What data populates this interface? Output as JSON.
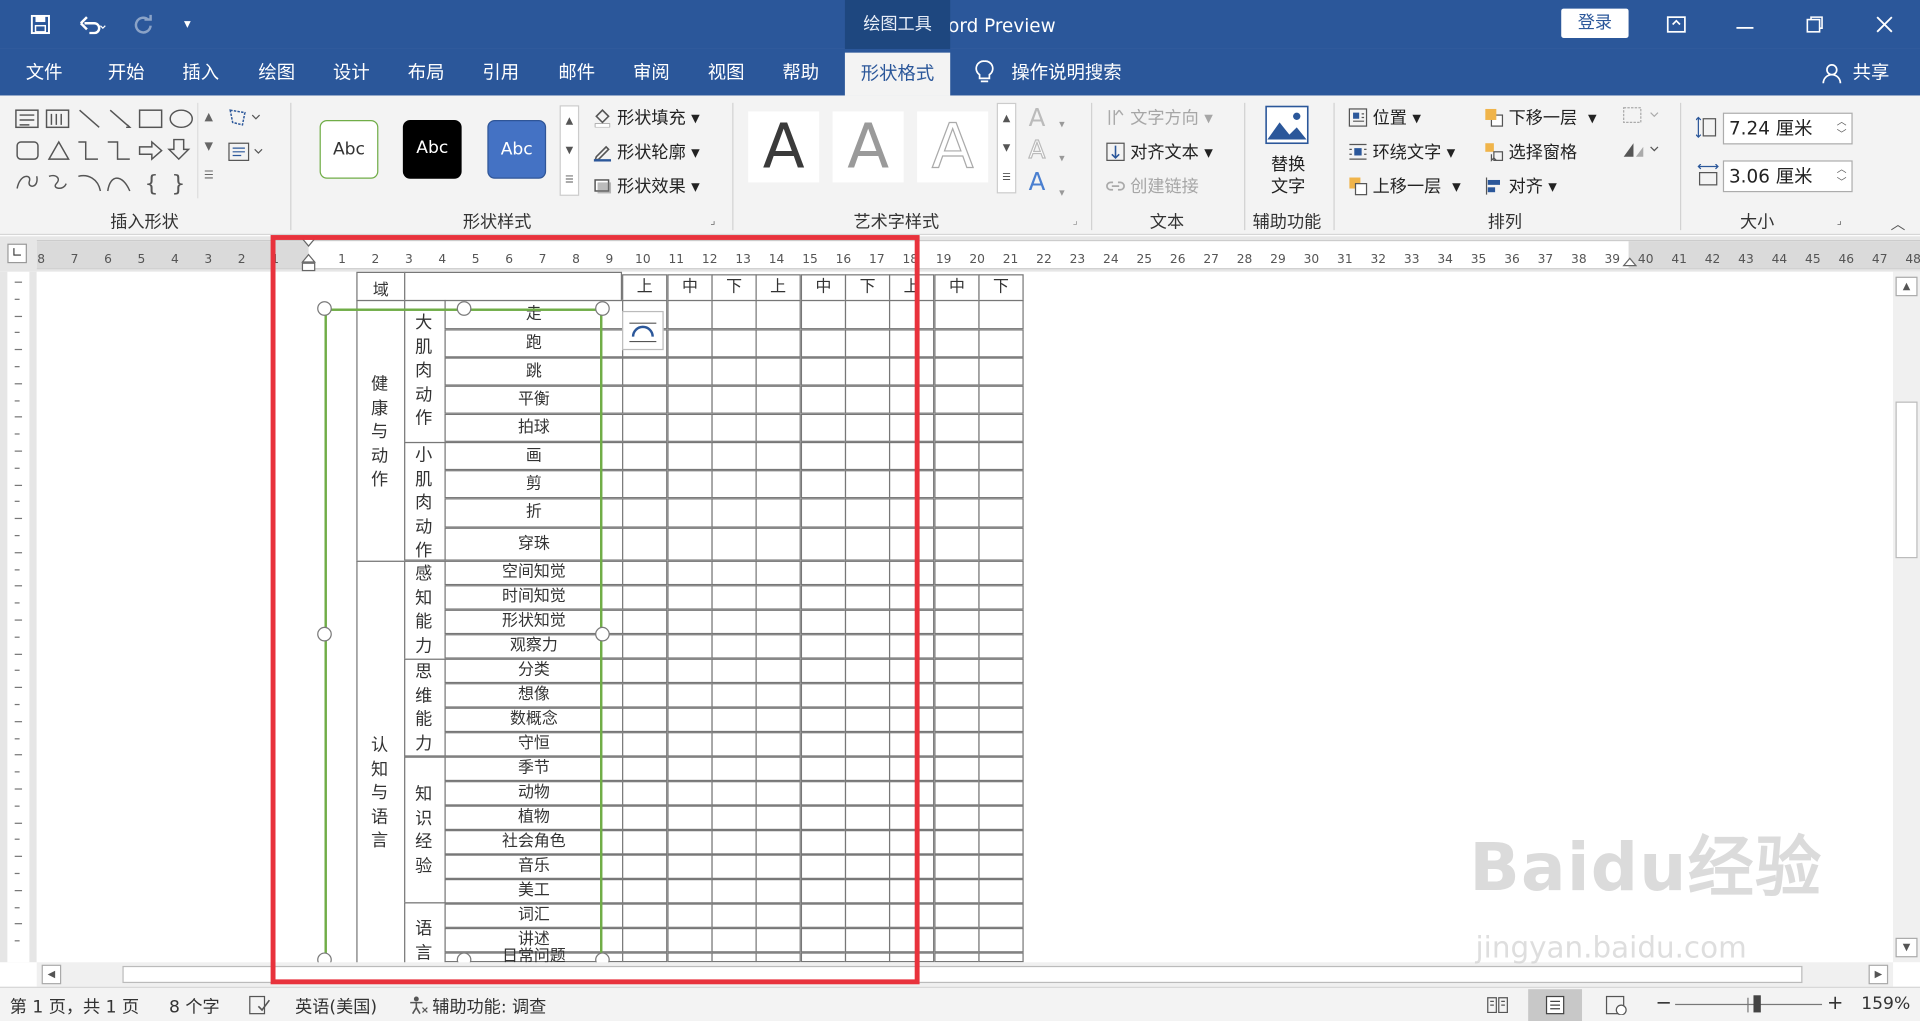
{
  "titlebar": {
    "doc_title": "文档5  -  Word Preview",
    "contextual_tab": "绘图工具",
    "login": "登录",
    "undo_icon": "undo-icon",
    "redo_icon": "redo-icon"
  },
  "tabs": [
    "文件",
    "开始",
    "插入",
    "绘图",
    "设计",
    "布局",
    "引用",
    "邮件",
    "审阅",
    "视图",
    "帮助",
    "形状格式"
  ],
  "search": {
    "label": "操作说明搜索"
  },
  "share": {
    "label": "共享"
  },
  "ribbon": {
    "groups": {
      "insert_shapes": "插入形状",
      "shape_styles": "形状样式",
      "wordart_styles": "艺术字样式",
      "text": "文本",
      "accessibility": "辅助功能",
      "arrange": "排列",
      "size": "大小"
    },
    "shape_style_samples": [
      "Abc",
      "Abc",
      "Abc"
    ],
    "shape_fill": "形状填充",
    "shape_outline": "形状轮廓",
    "shape_effects": "形状效果",
    "wordart_glyph": "A",
    "text_direction": "文字方向",
    "align_text": "对齐文本",
    "create_link": "创建链接",
    "alt_text_line1": "替换",
    "alt_text_line2": "文字",
    "position": "位置",
    "wrap_text": "环绕文字",
    "bring_forward": "上移一层",
    "send_backward": "下移一层",
    "selection_pane": "选择窗格",
    "align": "对齐",
    "height": "7.24 厘米",
    "width": "3.06 厘米"
  },
  "ruler": {
    "left_marks": [
      "8",
      "7",
      "6",
      "5",
      "4",
      "3",
      "2",
      "1"
    ],
    "right_marks": [
      "1",
      "2",
      "3",
      "4",
      "5",
      "6",
      "7",
      "8",
      "9",
      "10",
      "11",
      "12",
      "13",
      "14",
      "15",
      "16",
      "17",
      "18",
      "19",
      "20",
      "21",
      "22",
      "23",
      "24",
      "25",
      "26",
      "27",
      "28",
      "29",
      "30",
      "31",
      "32",
      "33",
      "34",
      "35",
      "36",
      "37",
      "38",
      "39",
      "40",
      "41",
      "42",
      "43",
      "44",
      "45",
      "46",
      "47",
      "48"
    ]
  },
  "table": {
    "header_fragment": "域",
    "term_headers": [
      "上",
      "中",
      "下",
      "上",
      "中",
      "下",
      "上",
      "中",
      "下"
    ],
    "domains": [
      "健康与动作",
      "认知与语言"
    ],
    "subdomains": [
      "大肌肉动作",
      "小肌肉动作",
      "感知能力",
      "思维能力",
      "知识经验",
      "语言"
    ],
    "items_upper": [
      "走",
      "跑",
      "跳",
      "平衡",
      "拍球",
      "画",
      "剪",
      "折",
      "穿珠"
    ],
    "items_lower": [
      "空间知觉",
      "时间知觉",
      "形状知觉",
      "观察力",
      "分类",
      "想像",
      "数概念",
      "守恒",
      "季节",
      "动物",
      "植物",
      "社会角色",
      "音乐",
      "美工",
      "词汇",
      "讲述",
      "日常问题"
    ]
  },
  "statusbar": {
    "page": "第 1 页，共 1 页",
    "words": "8 个字",
    "language": "英语(美国)",
    "accessibility": "辅助功能: 调查",
    "zoom": "159%"
  },
  "watermark": {
    "brand": "Baidu经验",
    "url": "jingyan.baidu.com"
  },
  "colors": {
    "accent": "#2b579a",
    "highlight_box": "#e8323c",
    "shape_outline": "#70ad47"
  }
}
